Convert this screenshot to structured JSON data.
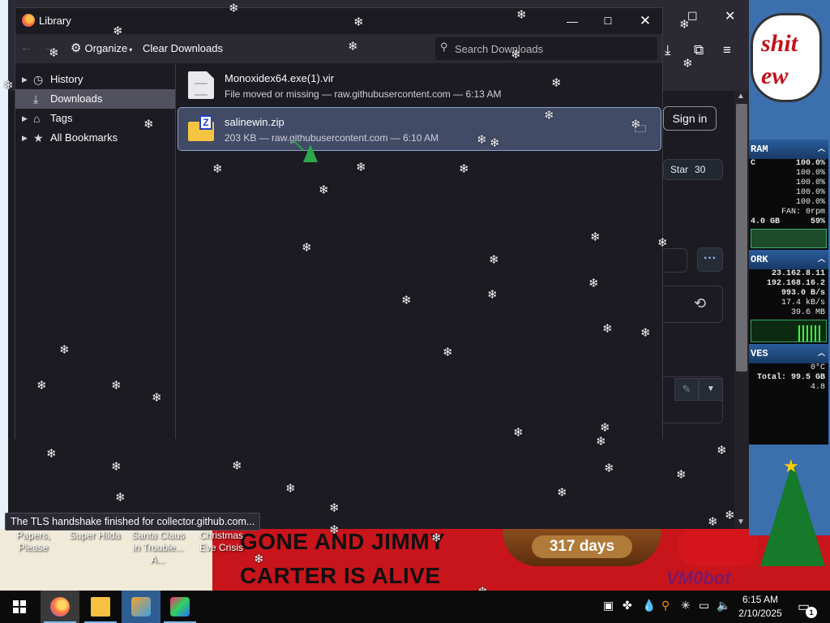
{
  "library": {
    "window_title": "Library",
    "controls": {
      "minimize": "—",
      "maximize": "☐",
      "close": "✕"
    },
    "toolbar": {
      "back_icon": "←",
      "forward_icon": "→",
      "organize_label": "Organize",
      "clear_downloads_label": "Clear Downloads",
      "search_placeholder": "Search Downloads"
    },
    "sidebar": [
      {
        "label": "History",
        "icon": "clock-icon",
        "glyph": "◷",
        "expandable": true,
        "selected": false
      },
      {
        "label": "Downloads",
        "icon": "download-icon",
        "glyph": "⤓",
        "expandable": false,
        "selected": true
      },
      {
        "label": "Tags",
        "icon": "tag-icon",
        "glyph": "⌂",
        "expandable": true,
        "selected": false
      },
      {
        "label": "All Bookmarks",
        "icon": "star-icon",
        "glyph": "★",
        "expandable": true,
        "selected": false
      }
    ],
    "downloads": [
      {
        "name": "Monoxidex64.exe(1).vir",
        "meta": "File moved or missing — raw.githubusercontent.com — 6:13 AM",
        "icon": "file-icon",
        "selected": false
      },
      {
        "name": "salinewin.zip",
        "meta": "203 KB — raw.githubusercontent.com — 6:10 AM",
        "icon": "zip-icon",
        "selected": true
      }
    ]
  },
  "browser": {
    "sign_in_label": "Sign in",
    "star_label": "Star",
    "star_count": "30",
    "more_label": "···",
    "status_text": "The TLS handshake finished for collector.github.com...",
    "restore_icon": "☐",
    "close_icon": "✕"
  },
  "desktop": {
    "icon_labels": [
      "Papers, Please",
      "Super Hilda",
      "Santa Claus in Trouble... A...",
      "Christmas Eve Crisis"
    ],
    "banner_line_1": "GONE AND JIMMY",
    "banner_line_2": "CARTER IS ALIVE",
    "days_badge": "317 days",
    "bubble_text_1": "shit",
    "bubble_text_2": "ew",
    "caption": "VM0bot"
  },
  "gadget": {
    "ram_title": "RAM",
    "ram_rows": [
      "100.0%",
      "100.0%",
      "100.0%",
      "100.0%",
      "100.0%"
    ],
    "ram_row_prefix": "C",
    "fan": "FAN: 0rpm",
    "ram_total": "4.0 GB",
    "ram_pct": "59%",
    "network_title": "ORK",
    "ip_1": "23.162.8.11",
    "ip_2": "192.168.16.2",
    "rate_1": "993.0 B/s",
    "rate_2": "17.4 kB/s",
    "rate_3": "39.6 MB",
    "drives_title": "VES",
    "temp": "0°C",
    "drives_total": "Total: 99.5 GB",
    "drives_sub": "4.8"
  },
  "taskbar": {
    "time": "6:15 AM",
    "date": "2/10/2025",
    "notification_count": "1",
    "apps": [
      "firefox",
      "file-explorer",
      "app-3",
      "app-4"
    ]
  },
  "colors": {
    "window_bg": "#1c1b22",
    "toolbar_bg": "#2b2a33",
    "selection_bg": "#414b66",
    "accent": "#76b9ed",
    "banner_red": "#c8141b"
  }
}
